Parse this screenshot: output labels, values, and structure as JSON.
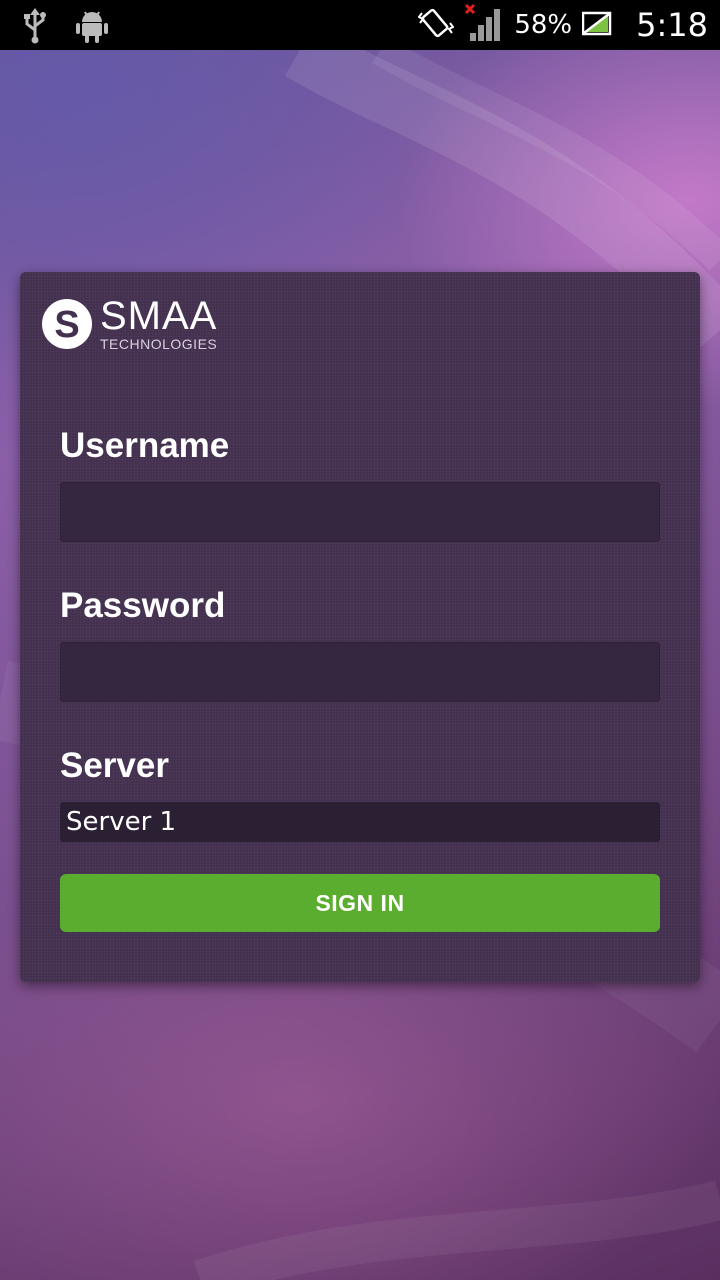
{
  "status_bar": {
    "icons": [
      "usb-icon",
      "android-icon",
      "vibrate-icon",
      "signal-icon",
      "battery-charging-icon"
    ],
    "battery_percent": "58%",
    "time": "5:18"
  },
  "logo": {
    "name": "SMAA",
    "subtitle": "TECHNOLOGIES"
  },
  "form": {
    "username_label": "Username",
    "username_value": "",
    "password_label": "Password",
    "password_value": "",
    "server_label": "Server",
    "server_selected": "Server 1",
    "sign_in_label": "SIGN IN"
  },
  "colors": {
    "card_background": "#43304f",
    "input_background": "#35273f",
    "button_green": "#5bad2f",
    "signal_error": "#e02020"
  }
}
